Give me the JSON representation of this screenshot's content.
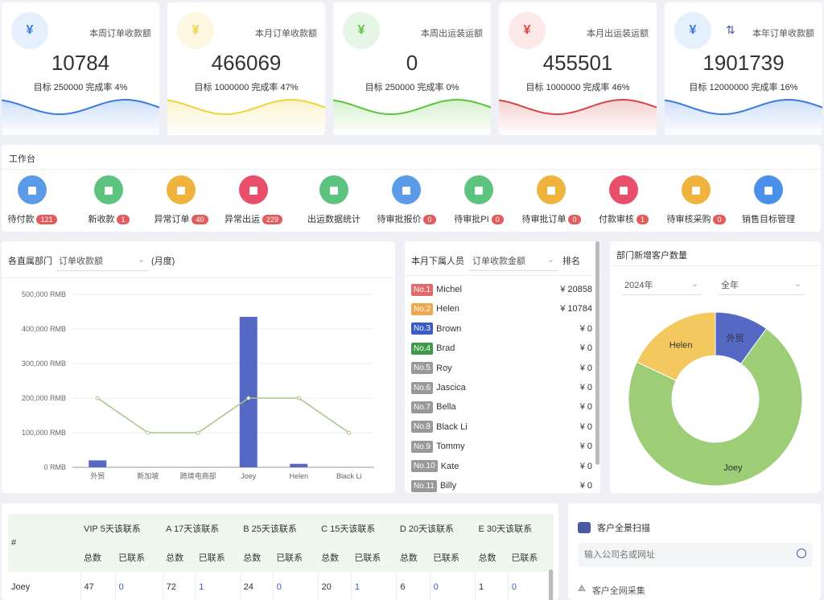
{
  "cards": [
    {
      "label": "本周订单收款额",
      "value": "10784",
      "target": "目标 250000 完成率 4%",
      "color": "#3a7be0",
      "icon": "yen-icon",
      "bg": "#e6f0fd"
    },
    {
      "label": "本月订单收款额",
      "value": "466069",
      "target": "目标 1000000 完成率 47%",
      "color": "#f0d23a",
      "icon": "yen-icon",
      "bg": "#fdf6e0"
    },
    {
      "label": "本周出运装运额",
      "value": "0",
      "target": "目标 250000 完成率 0%",
      "color": "#5ac43a",
      "icon": "yen-icon",
      "bg": "#e6f6e4"
    },
    {
      "label": "本月出运装运额",
      "value": "455501",
      "target": "目标 1000000 完成率 46%",
      "color": "#d84545",
      "icon": "yen-icon",
      "bg": "#fde8e8"
    },
    {
      "label": "本年订单收款额",
      "value": "1901739",
      "target": "目标 12000000 完成率 16%",
      "color": "#3a7be0",
      "icon": "yen-icon",
      "bg": "#e6f0fd"
    }
  ],
  "workbench": {
    "title": "工作台",
    "items": [
      {
        "label": "待付款",
        "badge": "121",
        "color": "#5b9be8",
        "icon": "receipt-icon"
      },
      {
        "label": "新收款",
        "badge": "1",
        "color": "#5cc47f",
        "icon": "money-bag-icon"
      },
      {
        "label": "异常订单",
        "badge": "40",
        "color": "#f0b43e",
        "icon": "order-star-icon"
      },
      {
        "label": "异常出运",
        "badge": "229",
        "color": "#e84f6a",
        "icon": "shield-alert-icon"
      },
      {
        "label": "出运数据统计",
        "badge": "",
        "color": "#5cc47f",
        "icon": "monitor-chart-icon"
      },
      {
        "label": "待审批报价",
        "badge": "0",
        "color": "#5b9be8",
        "icon": "document-edit-icon"
      },
      {
        "label": "待审批PI",
        "badge": "0",
        "color": "#5cc47f",
        "icon": "document-star-icon"
      },
      {
        "label": "待审批订单",
        "badge": "0",
        "color": "#f0b43e",
        "icon": "stamp-icon"
      },
      {
        "label": "付款审核",
        "badge": "1",
        "color": "#e84f6a",
        "icon": "invoice-yen-icon"
      },
      {
        "label": "待审核采购",
        "badge": "0",
        "color": "#f0b43e",
        "icon": "cart-icon"
      },
      {
        "label": "销售目标管理",
        "badge": "",
        "color": "#4a8fe8",
        "icon": "target-icon"
      }
    ]
  },
  "dept_chart": {
    "title": "各直属部门",
    "select": "订单收款额",
    "suffix": "(月度)"
  },
  "chart_data": [
    {
      "type": "bar",
      "categories": [
        "外贸",
        "新加坡",
        "跨境电商部",
        "Joey",
        "Helen",
        "Black Li"
      ],
      "series": [
        {
          "type": "bar",
          "values": [
            20000,
            0,
            0,
            435000,
            10000,
            0
          ],
          "color": "#5468c4"
        },
        {
          "type": "line",
          "values": [
            200000,
            100000,
            100000,
            200000,
            200000,
            100000
          ],
          "color": "#a8c48a"
        }
      ],
      "yticks": [
        "0 RMB",
        "100,000 RMB",
        "200,000 RMB",
        "300,000 RMB",
        "400,000 RMB",
        "500,000 RMB"
      ],
      "ylim": [
        0,
        500000
      ],
      "grid": true
    },
    {
      "type": "pie",
      "title": "部门新增客户数量",
      "labels": [
        "外贸",
        "Joey",
        "Helen"
      ],
      "values": [
        10,
        72,
        18
      ],
      "colors": [
        "#5468c4",
        "#9dcd76",
        "#f3c85e"
      ],
      "donut": true
    }
  ],
  "ranking": {
    "title": "本月下属人员",
    "select": "订单收款金额",
    "col": "排名",
    "rows": [
      {
        "no": "No.1",
        "name": "Michel",
        "value": "¥ 20858",
        "color": "#e06b6b"
      },
      {
        "no": "No.2",
        "name": "Helen",
        "value": "¥ 10784",
        "color": "#f0a850"
      },
      {
        "no": "No.3",
        "name": "Brown",
        "value": "¥ 0",
        "color": "#3a5bc4"
      },
      {
        "no": "No.4",
        "name": "Brad",
        "value": "¥ 0",
        "color": "#3e9a4a"
      },
      {
        "no": "No.5",
        "name": "Roy",
        "value": "¥ 0",
        "color": "#999"
      },
      {
        "no": "No.6",
        "name": "Jascica",
        "value": "¥ 0",
        "color": "#999"
      },
      {
        "no": "No.7",
        "name": "Bella",
        "value": "¥ 0",
        "color": "#999"
      },
      {
        "no": "No.8",
        "name": "Black Li",
        "value": "¥ 0",
        "color": "#999"
      },
      {
        "no": "No.9",
        "name": "Tommy",
        "value": "¥ 0",
        "color": "#999"
      },
      {
        "no": "No.10",
        "name": "Kate",
        "value": "¥ 0",
        "color": "#999"
      },
      {
        "no": "No.11",
        "name": "Billy",
        "value": "¥ 0",
        "color": "#999"
      }
    ]
  },
  "pie_filters": {
    "year": "2024年",
    "scope": "全年"
  },
  "contact_table": {
    "hash": "#",
    "groups": [
      "VIP 5天该联系",
      "A 17天该联系",
      "B 25天该联系",
      "C 15天该联系",
      "D 20天该联系",
      "E 30天该联系"
    ],
    "sub": [
      "总数",
      "已联系"
    ],
    "rows": [
      {
        "name": "Joey",
        "cells": [
          "47",
          "0",
          "72",
          "1",
          "24",
          "0",
          "20",
          "1",
          "6",
          "0",
          "1",
          "0"
        ]
      }
    ]
  },
  "scan": {
    "title": "客户全景扫描",
    "placeholder": "输入公司名或网址",
    "next": "客户全网采集"
  }
}
